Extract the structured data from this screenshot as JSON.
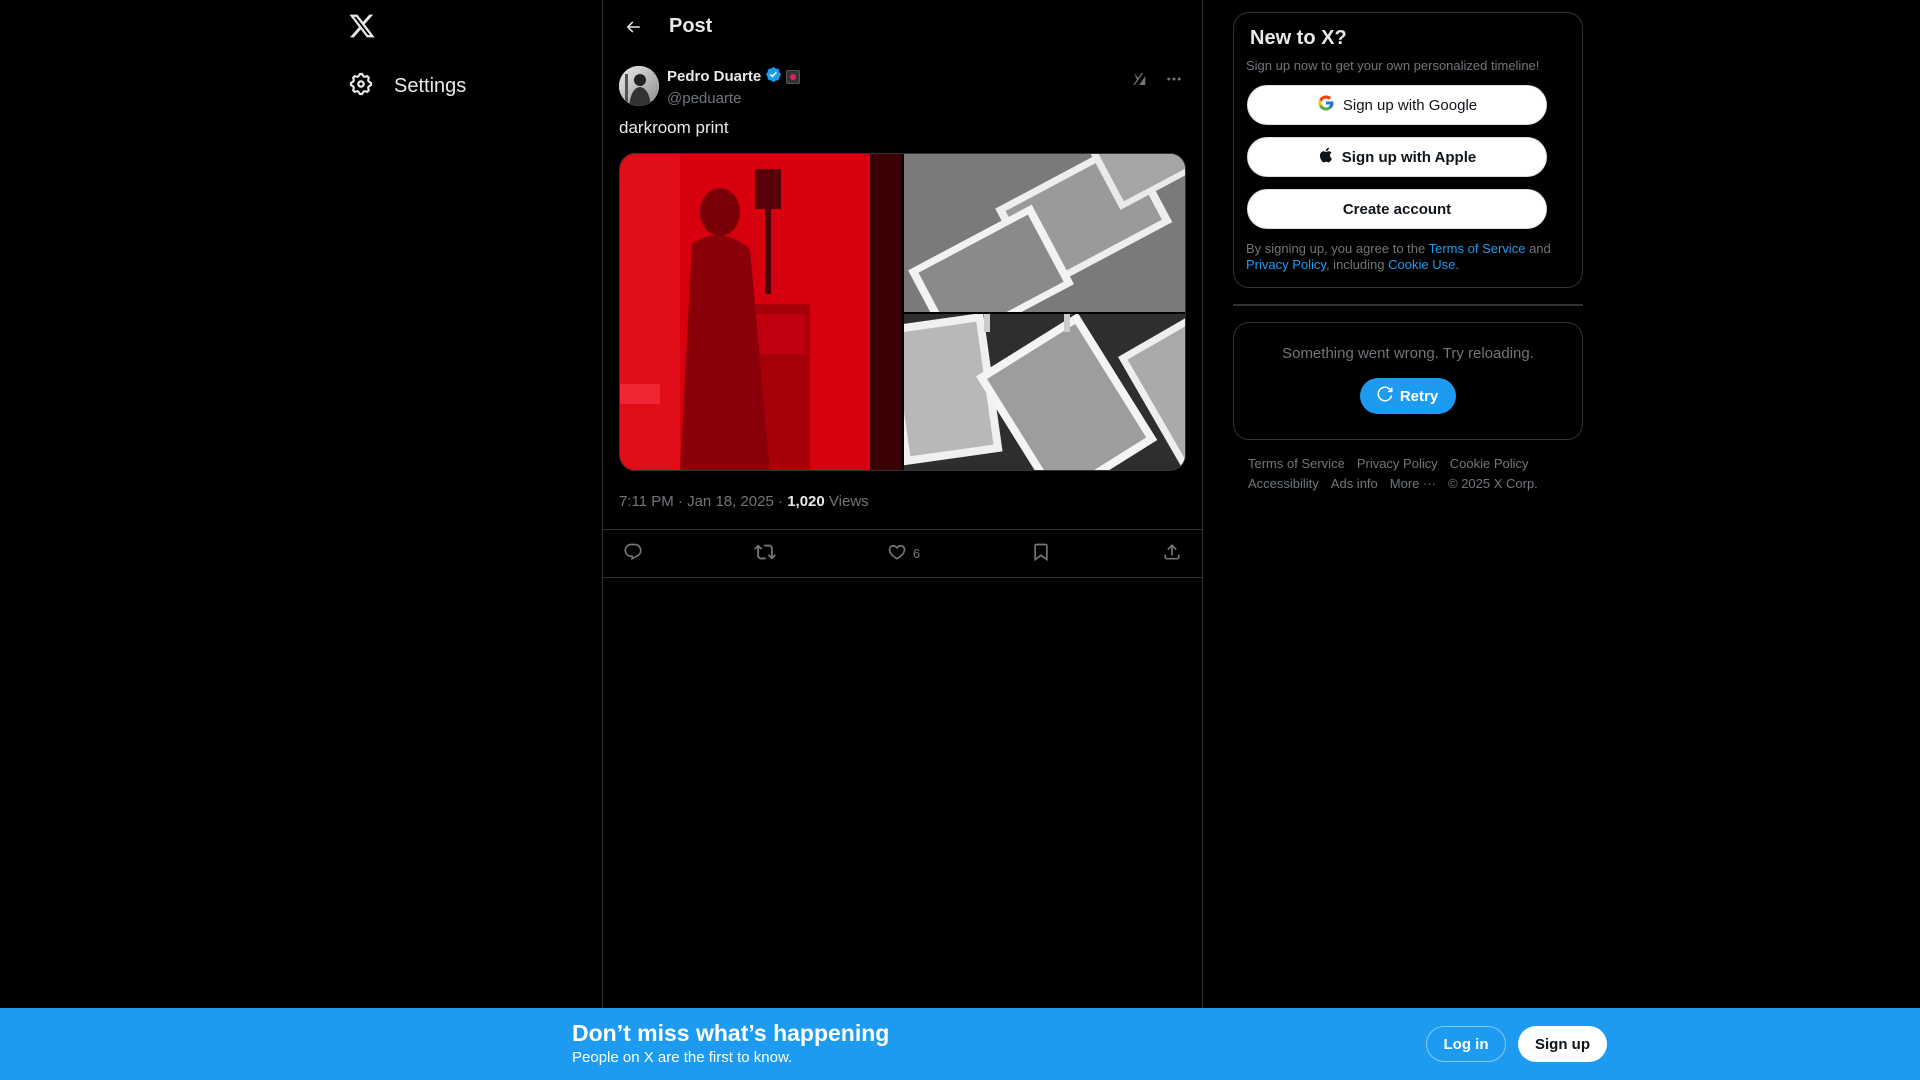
{
  "nav": {
    "settings_label": "Settings"
  },
  "header": {
    "title": "Post"
  },
  "post": {
    "author_name": "Pedro Duarte",
    "author_handle": "@peduarte",
    "text": "darkroom print",
    "time": "7:11 PM",
    "date": "Jan 18, 2025",
    "views_count": "1,020",
    "views_label": "Views",
    "likes_count": "6",
    "verified_color": "#1d9bf0"
  },
  "signup_card": {
    "title": "New to X?",
    "subtitle": "Sign up now to get your own personalized timeline!",
    "google_label": "Sign up with Google",
    "apple_label": "Sign up with Apple",
    "create_label": "Create account",
    "legal_prefix": "By signing up, you agree to the",
    "terms": "Terms of Service",
    "and": "and",
    "privacy": "Privacy Policy",
    "including": ", including",
    "cookie": "Cookie Use."
  },
  "error_card": {
    "message": "Something went wrong. Try reloading.",
    "retry_label": "Retry"
  },
  "footer": {
    "links": [
      "Terms of Service",
      "Privacy Policy",
      "Cookie Policy",
      "Accessibility",
      "Ads info",
      "More ···",
      "© 2025 X Corp."
    ]
  },
  "banner": {
    "title": "Don’t miss what’s happening",
    "subtitle": "People on X are the first to know.",
    "login_label": "Log in",
    "signup_label": "Sign up",
    "color": "#1d9bf0"
  }
}
